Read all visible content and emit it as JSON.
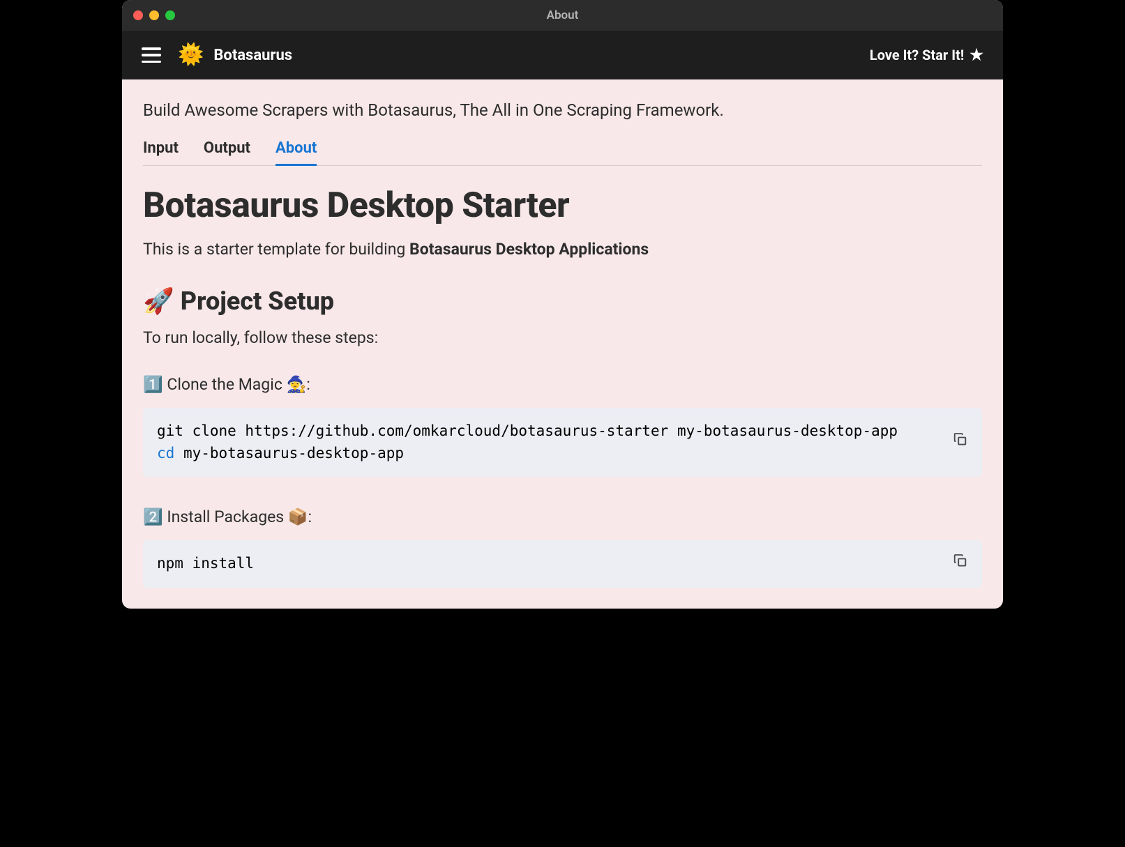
{
  "window": {
    "title": "About"
  },
  "header": {
    "app_name": "Botasaurus",
    "star_label": "Love It? Star It!"
  },
  "content": {
    "tagline": "Build Awesome Scrapers with Botasaurus, The All in One Scraping Framework.",
    "main_heading": "Botasaurus Desktop Starter",
    "intro_prefix": "This is a starter template for building ",
    "intro_bold": "Botasaurus Desktop Applications",
    "section_heading": "🚀 Project Setup",
    "section_intro": "To run locally, follow these steps:",
    "step1_label": "1️⃣ Clone the Magic 🧙‍♀️:",
    "step2_label": "2️⃣ Install Packages 📦:"
  },
  "tabs": [
    {
      "label": "Input",
      "active": false
    },
    {
      "label": "Output",
      "active": false
    },
    {
      "label": "About",
      "active": true
    }
  ],
  "code": {
    "block1_line1": "git clone https://github.com/omkarcloud/botasaurus-starter my-botasaurus-desktop-app",
    "block1_cd": "cd",
    "block1_cd_arg": " my-botasaurus-desktop-app",
    "block2_line1": "npm install"
  }
}
